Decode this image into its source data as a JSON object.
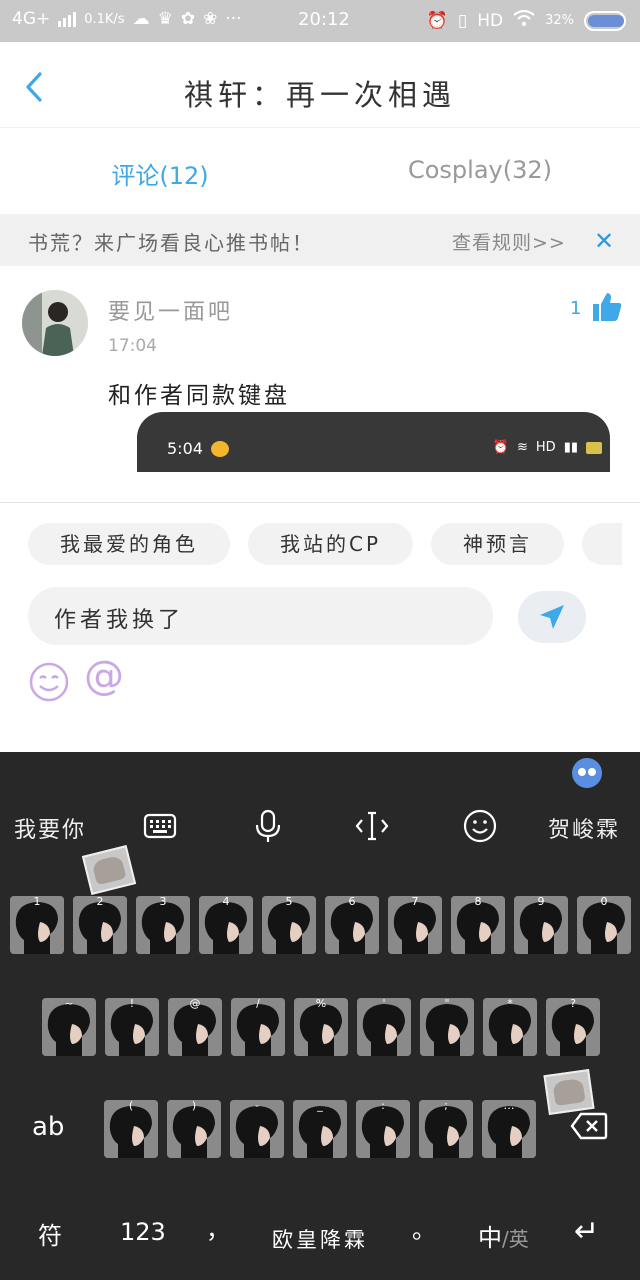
{
  "status_bar": {
    "network": "4G+",
    "speed": "0.1K/s",
    "time": "20:12",
    "hd": "HD",
    "battery": "32%"
  },
  "header": {
    "title": "祺轩：再一次相遇"
  },
  "tabs": [
    {
      "label": "评论(12)",
      "active": true
    },
    {
      "label": "Cosplay(32)",
      "active": false
    }
  ],
  "notice": {
    "text": "书荒？来广场看良心推书帖！",
    "link": "查看规则>>",
    "close": "✕"
  },
  "comment": {
    "user": "要见一面吧",
    "time": "17:04",
    "likes": "1",
    "text": "和作者同款键盘",
    "screenshot": {
      "time": "5:04",
      "hd": "HD"
    }
  },
  "chips": [
    "我最爱的角色",
    "我站的CP",
    "神预言"
  ],
  "input": {
    "value": "作者我换了"
  },
  "at_symbol": "@",
  "keyboard": {
    "toolbar_left": "我要你",
    "toolbar_right": "贺峻霖",
    "row1_labels": [
      "1",
      "2",
      "3",
      "4",
      "5",
      "6",
      "7",
      "8",
      "9",
      "0"
    ],
    "row2_labels": [
      "~",
      "!",
      "@",
      "/",
      "%",
      "'",
      "\"",
      "*",
      "?"
    ],
    "row3_labels": [
      "(",
      ")",
      "-",
      "_",
      ":",
      ";",
      "…"
    ],
    "ab": "ab",
    "fu": "符",
    "num": "123",
    "comma": "，",
    "space": "欧皇降霖",
    "period": "。",
    "lang_cn": "中",
    "lang_en": "/英",
    "enter": "↵",
    "accent": "#3ea8e8"
  }
}
